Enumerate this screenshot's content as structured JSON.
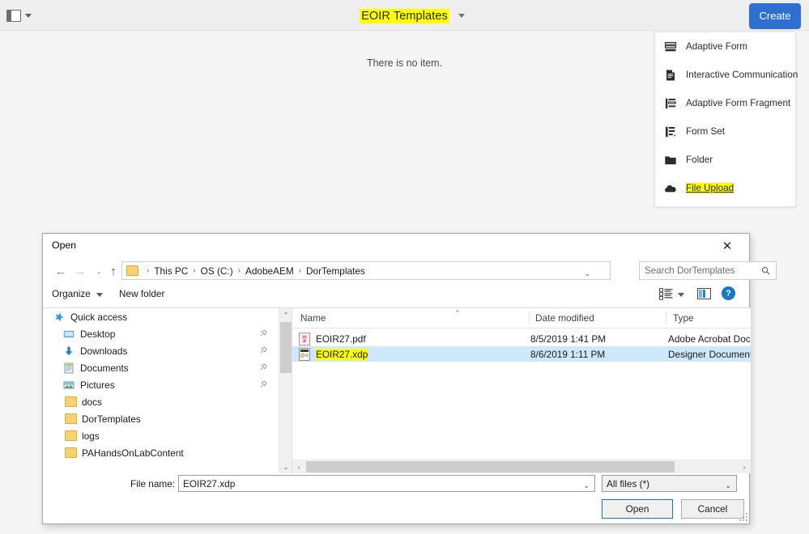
{
  "header": {
    "rail_icon": "rail-toggle-icon",
    "title": "EOIR Templates",
    "title_caret": "chevron-down-icon",
    "create_label": "Create"
  },
  "main": {
    "empty_message": "There is no item."
  },
  "create_menu": {
    "items": [
      {
        "label": "Adaptive Form",
        "icon": "adaptive-form-icon",
        "highlighted": false
      },
      {
        "label": "Interactive Communication",
        "icon": "interactive-communication-icon",
        "highlighted": false
      },
      {
        "label": "Adaptive Form Fragment",
        "icon": "adaptive-form-fragment-icon",
        "highlighted": false
      },
      {
        "label": "Form Set",
        "icon": "form-set-icon",
        "highlighted": false
      },
      {
        "label": "Folder",
        "icon": "folder-icon",
        "highlighted": false
      },
      {
        "label": "File Upload",
        "icon": "file-upload-icon",
        "highlighted": true
      }
    ]
  },
  "dialog": {
    "title": "Open",
    "close_label": "✕",
    "nav": {
      "back": "←",
      "forward": "→",
      "recent": "⌄",
      "up": "↑"
    },
    "breadcrumb": {
      "segments": [
        "This PC",
        "OS (C:)",
        "AdobeAEM",
        "DorTemplates"
      ],
      "separator": "›",
      "caret": "⌄",
      "refresh": "↻"
    },
    "search": {
      "placeholder": "Search DorTemplates",
      "icon": "search-icon"
    },
    "commandbar": {
      "organize": "Organize",
      "new_folder": "New folder",
      "view_icon": "view-layout-icon",
      "preview_pane_icon": "preview-pane-icon",
      "help_icon": "help-icon",
      "help_glyph": "?"
    },
    "navpane": {
      "items": [
        {
          "label": "Quick access",
          "icon": "quick-access-star-icon",
          "pinned": false,
          "indent": 0
        },
        {
          "label": "Desktop",
          "icon": "desktop-icon",
          "pinned": true,
          "indent": 1
        },
        {
          "label": "Downloads",
          "icon": "downloads-icon",
          "pinned": true,
          "indent": 1
        },
        {
          "label": "Documents",
          "icon": "documents-icon",
          "pinned": true,
          "indent": 1
        },
        {
          "label": "Pictures",
          "icon": "pictures-icon",
          "pinned": true,
          "indent": 1
        },
        {
          "label": "docs",
          "icon": "folder-icon",
          "pinned": false,
          "indent": 1
        },
        {
          "label": "DorTemplates",
          "icon": "folder-icon",
          "pinned": false,
          "indent": 1
        },
        {
          "label": "logs",
          "icon": "folder-icon",
          "pinned": false,
          "indent": 1
        },
        {
          "label": "PAHandsOnLabContent",
          "icon": "folder-icon",
          "pinned": false,
          "indent": 1
        }
      ],
      "pin_glyph": "✒"
    },
    "filelist": {
      "columns": [
        "Name",
        "Date modified",
        "Type"
      ],
      "sort_indicator": "⌃",
      "rows": [
        {
          "name": "EOIR27.pdf",
          "date": "8/5/2019 1:41 PM",
          "type": "Adobe Acrobat Docum",
          "icon": "pdf-file-icon",
          "selected": false,
          "highlighted": false
        },
        {
          "name": "EOIR27.xdp",
          "date": "8/6/2019 1:11 PM",
          "type": "Designer Document",
          "icon": "xdp-file-icon",
          "selected": true,
          "highlighted": true
        }
      ]
    },
    "footer": {
      "filename_label": "File name:",
      "filename_value": "EOIR27.xdp",
      "filetype_value": "All files (*)",
      "open_label": "Open",
      "cancel_label": "Cancel",
      "caret": "⌄"
    },
    "scroll": {
      "up": "⌃",
      "down": "⌄",
      "left": "‹",
      "right": "›"
    }
  },
  "colors": {
    "accent_blue": "#2f6fd0",
    "selection_blue": "#cde8ff",
    "highlight_yellow": "#ffff00",
    "header_gray": "#eeeeee",
    "page_bg": "#f5f5f5"
  }
}
